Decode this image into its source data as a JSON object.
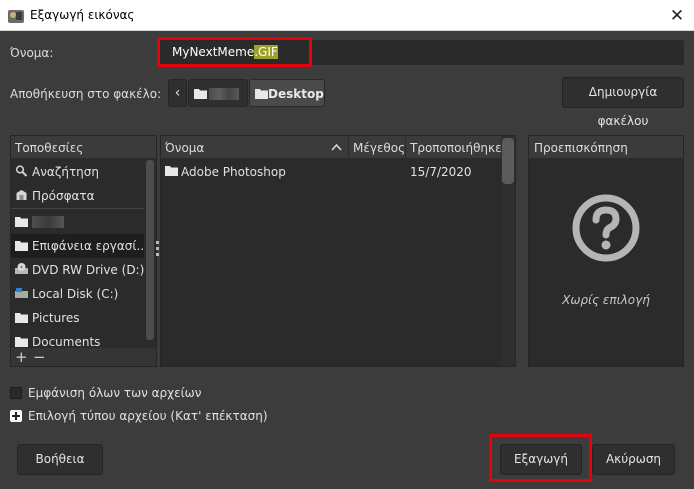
{
  "window": {
    "title": "Εξαγωγή εικόνας",
    "close_glyph": "✕",
    "icon": "gimp-app-icon"
  },
  "name_row": {
    "label": "Όνομα:",
    "value_base": "MyNextMeme",
    "value_selected": ".GIF"
  },
  "folder_row": {
    "label": "Αποθήκευση στο φακέλο:",
    "back_glyph": "‹",
    "current_folder": "Desktop",
    "create_folder_label": "Δημιουργία φακέλου"
  },
  "places": {
    "header": "Τοποθεσίες",
    "items": [
      {
        "label": "Αναζήτηση",
        "icon": "search-icon"
      },
      {
        "label": "Πρόσφατα",
        "icon": "recent-icon"
      },
      {
        "label": "",
        "icon": "folder-icon"
      },
      {
        "label": "Επιφάνεια εργασί...",
        "icon": "folder-icon",
        "active": true
      },
      {
        "label": "DVD RW Drive (D:)",
        "icon": "dvd-drive-icon"
      },
      {
        "label": "Local Disk (C:)",
        "icon": "disk-icon"
      },
      {
        "label": "Pictures",
        "icon": "folder-icon"
      },
      {
        "label": "Documents",
        "icon": "folder-icon"
      }
    ],
    "add_glyph": "+",
    "remove_glyph": "−"
  },
  "files": {
    "columns": {
      "name": "Όνομα",
      "size": "Μέγεθος",
      "modified": "Τροποποιήθηκε"
    },
    "rows": [
      {
        "name": "Adobe Photoshop",
        "size": "",
        "modified": "15/7/2020",
        "icon": "folder-icon"
      }
    ]
  },
  "preview": {
    "header": "Προεπισκόπηση",
    "empty_text": "Χωρίς επιλογή",
    "icon": "question-icon"
  },
  "options": {
    "show_all_files": "Εμφάνιση όλων των αρχείων",
    "select_file_type": "Επιλογή τύπου αρχείου (Κατ' επέκταση)"
  },
  "buttons": {
    "help": "Βοήθεια",
    "export": "Εξαγωγή",
    "cancel": "Ακύρωση"
  },
  "colors": {
    "background": "#3c3c3c",
    "highlight_box": "#e8000d",
    "selection": "#9ba12a"
  }
}
